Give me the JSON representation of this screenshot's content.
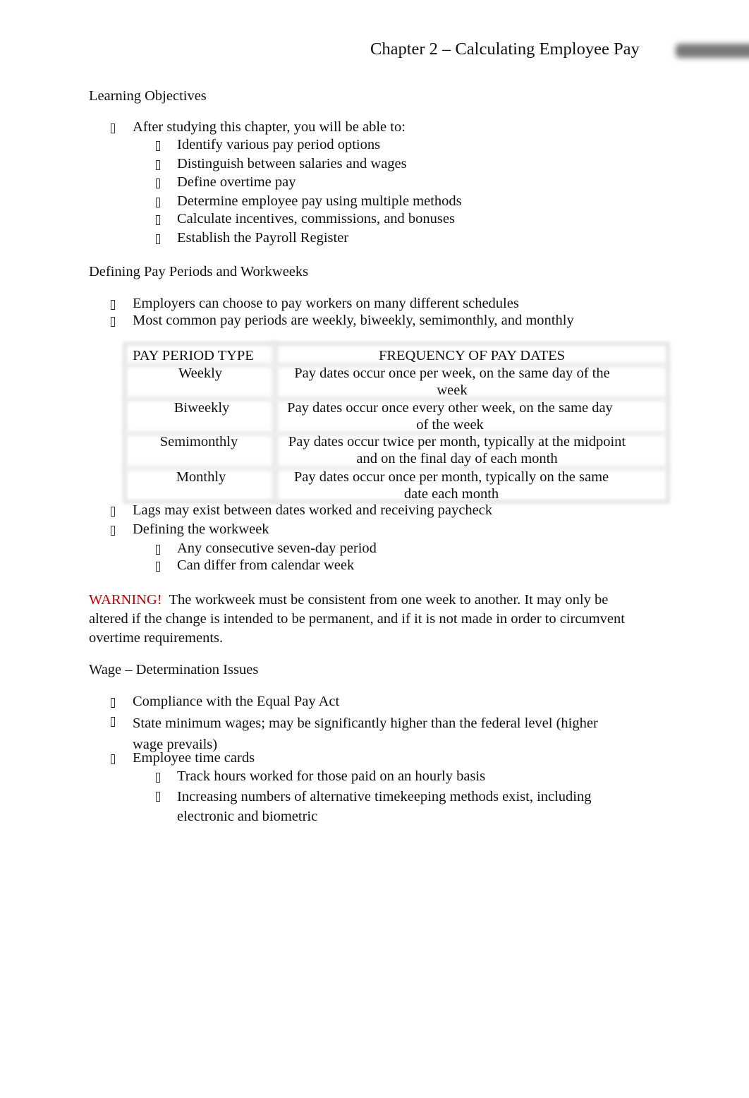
{
  "header": {
    "title": "Chapter 2 – Calculating Employee Pay"
  },
  "sections": {
    "learning_objectives": {
      "heading": "Learning Objectives",
      "intro": "After studying this chapter, you will be able to:",
      "items": [
        "Identify various pay period options",
        "Distinguish between salaries and wages",
        "Define overtime pay",
        "Determine employee pay using multiple methods",
        "Calculate incentives, commissions, and bonuses",
        "Establish the Payroll Register"
      ]
    },
    "pay_periods": {
      "heading": "Defining Pay Periods and Workweeks",
      "bullets": [
        "Employers can choose to pay workers on many different schedules",
        "Most common pay periods are weekly, biweekly, semimonthly, and monthly"
      ],
      "table": {
        "headers": [
          "PAY PERIOD TYPE",
          "FREQUENCY OF PAY DATES"
        ],
        "rows": [
          {
            "type": "Weekly",
            "frequency": "Pay dates occur once per week, on the same day of the week"
          },
          {
            "type": "Biweekly",
            "frequency": "Pay dates occur once every other week, on the same day of the week"
          },
          {
            "type": "Semimonthly",
            "frequency": "Pay dates occur twice per month, typically at the midpoint and on the final day of each month"
          },
          {
            "type": "Monthly",
            "frequency": "Pay dates occur once per month, typically on the same date each month"
          }
        ]
      },
      "bullets_after": [
        "Lags may exist between dates worked and receiving paycheck",
        "Defining the workweek"
      ],
      "workweek_items": [
        "Any consecutive seven-day period",
        "Can differ from calendar week"
      ]
    },
    "warning": {
      "label": "WARNING!",
      "text": "The workweek must be consistent from one week to another. It may only be altered if the change is intended to be permanent, and if it is not made in order to circumvent overtime requirements.",
      "color": "#c00000"
    },
    "wage_determination": {
      "heading": "Wage – Determination Issues",
      "bullets": [
        "Compliance with the Equal Pay Act",
        "State minimum wages; may be significantly higher than the federal level (higher wage prevails)",
        "Employee time cards"
      ],
      "time_card_items": [
        "Track hours worked for those paid on an hourly basis",
        "Increasing numbers of alternative timekeeping methods exist, including electronic and biometric"
      ]
    }
  }
}
